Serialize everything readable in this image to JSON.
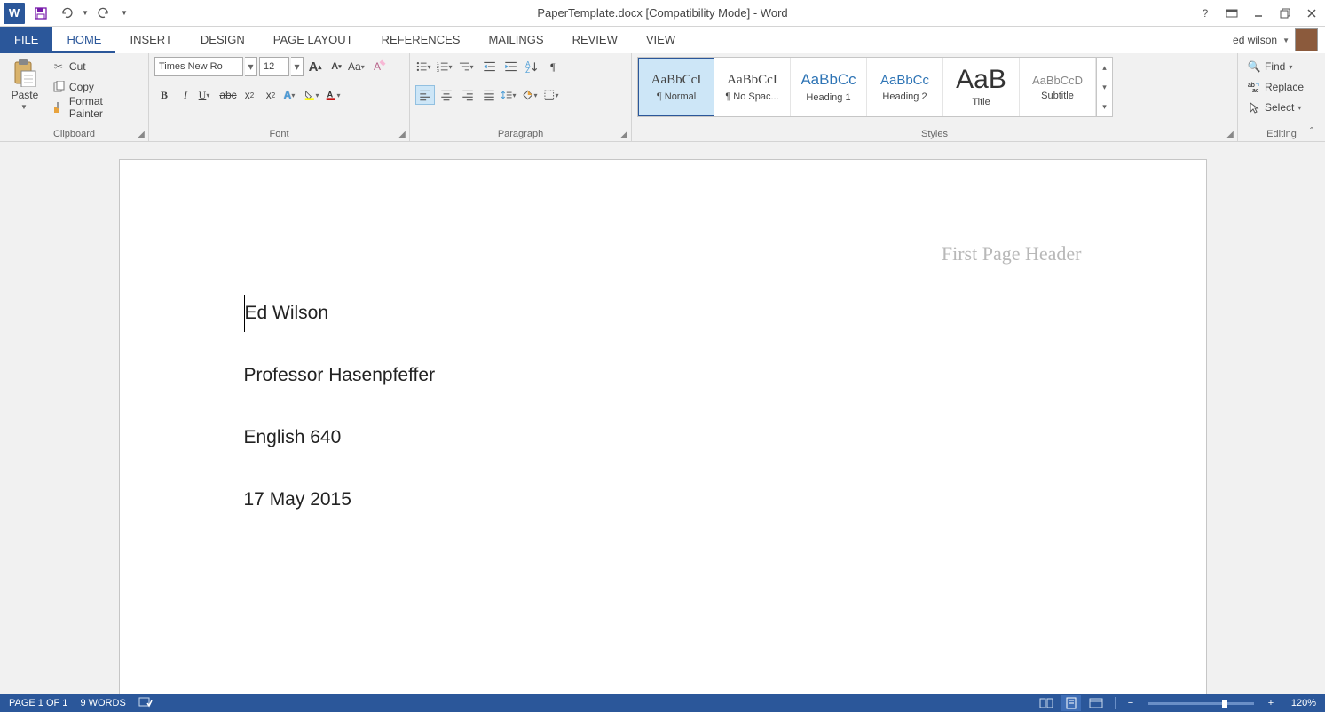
{
  "titlebar": {
    "title": "PaperTemplate.docx [Compatibility Mode] - Word"
  },
  "tabs": {
    "file": "FILE",
    "list": [
      "HOME",
      "INSERT",
      "DESIGN",
      "PAGE LAYOUT",
      "REFERENCES",
      "MAILINGS",
      "REVIEW",
      "VIEW"
    ],
    "active_index": 0
  },
  "user": {
    "name": "ed wilson"
  },
  "clipboard": {
    "paste": "Paste",
    "cut": "Cut",
    "copy": "Copy",
    "format_painter": "Format Painter",
    "label": "Clipboard"
  },
  "font": {
    "name": "Times New Ro",
    "size": "12",
    "label": "Font"
  },
  "paragraph": {
    "label": "Paragraph"
  },
  "styles": {
    "label": "Styles",
    "items": [
      {
        "preview": "AaBbCcI",
        "name": "¶ Normal",
        "selected": true,
        "cls": ""
      },
      {
        "preview": "AaBbCcI",
        "name": "¶ No Spac...",
        "selected": false,
        "cls": ""
      },
      {
        "preview": "AaBbCc",
        "name": "Heading 1",
        "selected": false,
        "cls": "heading"
      },
      {
        "preview": "AaBbCc",
        "name": "Heading 2",
        "selected": false,
        "cls": "heading"
      },
      {
        "preview": "AaB",
        "name": "Title",
        "selected": false,
        "cls": "title"
      },
      {
        "preview": "AaBbCcD",
        "name": "Subtitle",
        "selected": false,
        "cls": "heading"
      }
    ]
  },
  "editing": {
    "find": "Find",
    "replace": "Replace",
    "select": "Select",
    "label": "Editing"
  },
  "document": {
    "header": "First Page Header",
    "lines": [
      "Ed Wilson",
      "Professor Hasenpfeffer",
      "English 640",
      "17 May 2015"
    ]
  },
  "status": {
    "page": "PAGE 1 OF 1",
    "words": "9 WORDS",
    "zoom": "120%"
  }
}
